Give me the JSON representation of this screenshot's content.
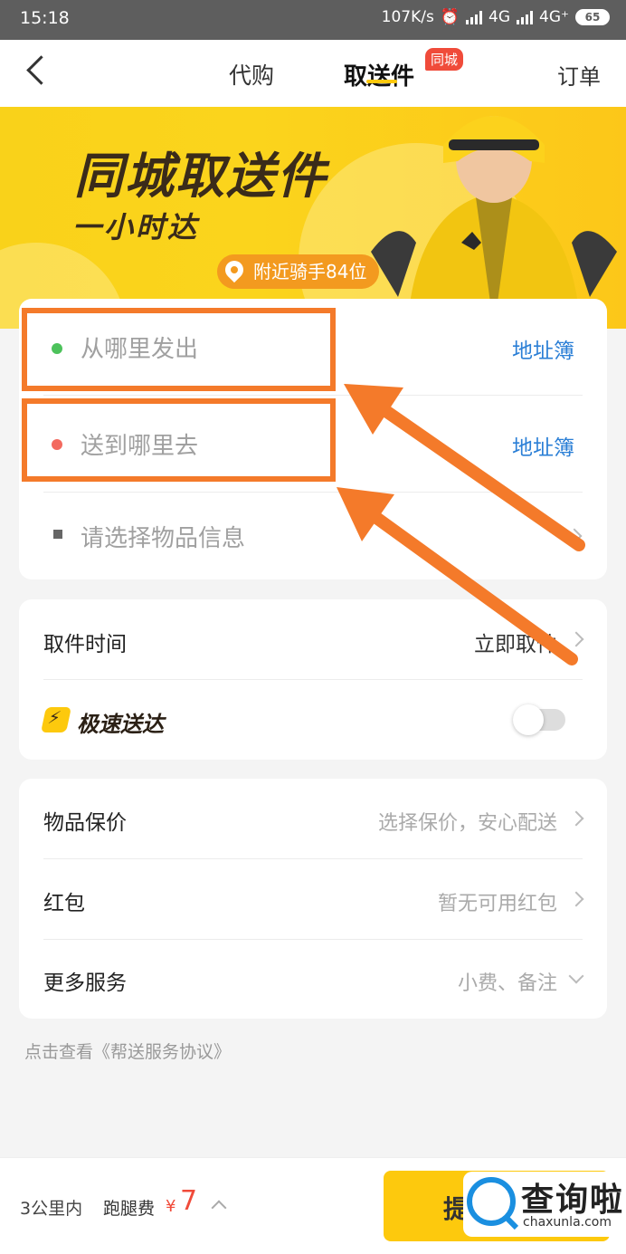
{
  "status_bar": {
    "time": "15:18",
    "speed": "107K/s",
    "net1": "4G",
    "net2": "4G⁺",
    "battery": "65"
  },
  "navbar": {
    "tab_daigou": "代购",
    "tab_qusongjian": "取送件",
    "badge": "同城",
    "orders": "订单"
  },
  "banner": {
    "title": "同城取送件",
    "subtitle": "一小时达",
    "riders": "附近骑手84位"
  },
  "address": {
    "from_placeholder": "从哪里发出",
    "to_placeholder": "送到哪里去",
    "book": "地址簿",
    "item_placeholder": "请选择物品信息"
  },
  "pickup": {
    "label": "取件时间",
    "value": "立即取件"
  },
  "express": {
    "label": "极速送达",
    "enabled": false
  },
  "extras": {
    "insurance_label": "物品保价",
    "insurance_value": "选择保价，安心配送",
    "redpacket_label": "红包",
    "redpacket_value": "暂无可用红包",
    "more_label": "更多服务",
    "more_value": "小费、备注"
  },
  "agreement": "点击查看《帮送服务协议》",
  "bottom": {
    "distance": "3公里内",
    "fee_label": "跑腿费",
    "currency": "¥",
    "price": "7",
    "submit": "提"
  },
  "watermark": {
    "cn": "查询啦",
    "en": "chaxunla.com"
  },
  "colors": {
    "accent": "#fdc90d",
    "link": "#2b7fd6",
    "highlight": "#f47a2a",
    "from_dot": "#4cc25b",
    "to_dot": "#f36a5f"
  }
}
